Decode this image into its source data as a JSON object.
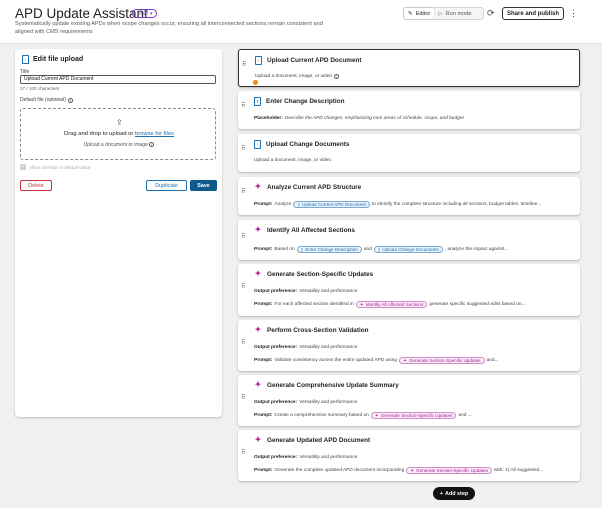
{
  "header": {
    "title": "APD Update Assistant",
    "badge": "Draft",
    "subtitle": "Systematically update existing APDs when scope changes occur, ensuring all interconnected sections remain consistent and aligned with CMS requirements",
    "mode_editor": "Editor",
    "mode_run": "Run mode",
    "share_label": "Share and publish"
  },
  "panel": {
    "heading": "Edit file upload",
    "title_label": "Title",
    "title_value": "Upload Current APD Document",
    "counter": "27 / 100 characters",
    "default_label": "Default file (optional)",
    "drop_text": "Drag and drop to upload or",
    "browse_text": "browse for files",
    "drop_sub": "Upload a document or image",
    "allow_label": "Allow override of default value",
    "delete_label": "Delete",
    "duplicate_label": "Duplicate",
    "save_label": "Save"
  },
  "steps": [
    {
      "title": "Upload Current APD Document",
      "line": "Upload a document, image, or video"
    },
    {
      "title": "Enter Change Description",
      "prefix": "Placeholder:",
      "line": "Describe the APD changes, emphasizing core areas of schedule, scope, and budget"
    },
    {
      "title": "Upload Change Documents",
      "line": "Upload a document, image, or video"
    },
    {
      "title": "Analyze Current APD Structure",
      "prefix": "Prompt:",
      "pre": "Analyze",
      "chip": "Upload Current APD Document",
      "post": "to identify the complete structure including all sections, budget tables, timeline..."
    },
    {
      "title": "Identify All Affected Sections",
      "prefix": "Prompt:",
      "pre": "Based on",
      "chip": "Enter Change Description",
      "mid": "and",
      "chip2": "Upload Change Documents",
      "post": ", analyze the impact against..."
    },
    {
      "title": "Generate Section-Specific Updates",
      "pref_label": "Output preference:",
      "pref_value": "Versatility and performance",
      "prefix": "Prompt:",
      "pre": "For each affected section identified in",
      "chip": "Identify All Affected Sections",
      "post": "generate specific suggested edits based on..."
    },
    {
      "title": "Perform Cross-Section Validation",
      "pref_label": "Output preference:",
      "pref_value": "Versatility and performance",
      "prefix": "Prompt:",
      "pre": "Validate consistency across the entire updated APD using",
      "chip": "Generate Section-Specific Updates",
      "post": "and..."
    },
    {
      "title": "Generate Comprehensive Update Summary",
      "pref_label": "Output preference:",
      "pref_value": "Versatility and performance",
      "prefix": "Prompt:",
      "pre": "Create a comprehensive summary based on",
      "chip": "Generate Section-Specific Updates",
      "post": "and ..."
    },
    {
      "title": "Generate Updated APD Document",
      "pref_label": "Output preference:",
      "pref_value": "Versatility and performance",
      "prefix": "Prompt:",
      "pre": "Generate the complete updated APD document incorporating",
      "chip": "Generate Section-Specific Updates",
      "post": "with: 1) All suggested..."
    }
  ],
  "add_step_label": "Add step",
  "colors": {
    "accent": "#0f5a8c",
    "ai_pink": "#b0279a",
    "danger": "#c8323c",
    "draft": "#7b3fd1"
  }
}
